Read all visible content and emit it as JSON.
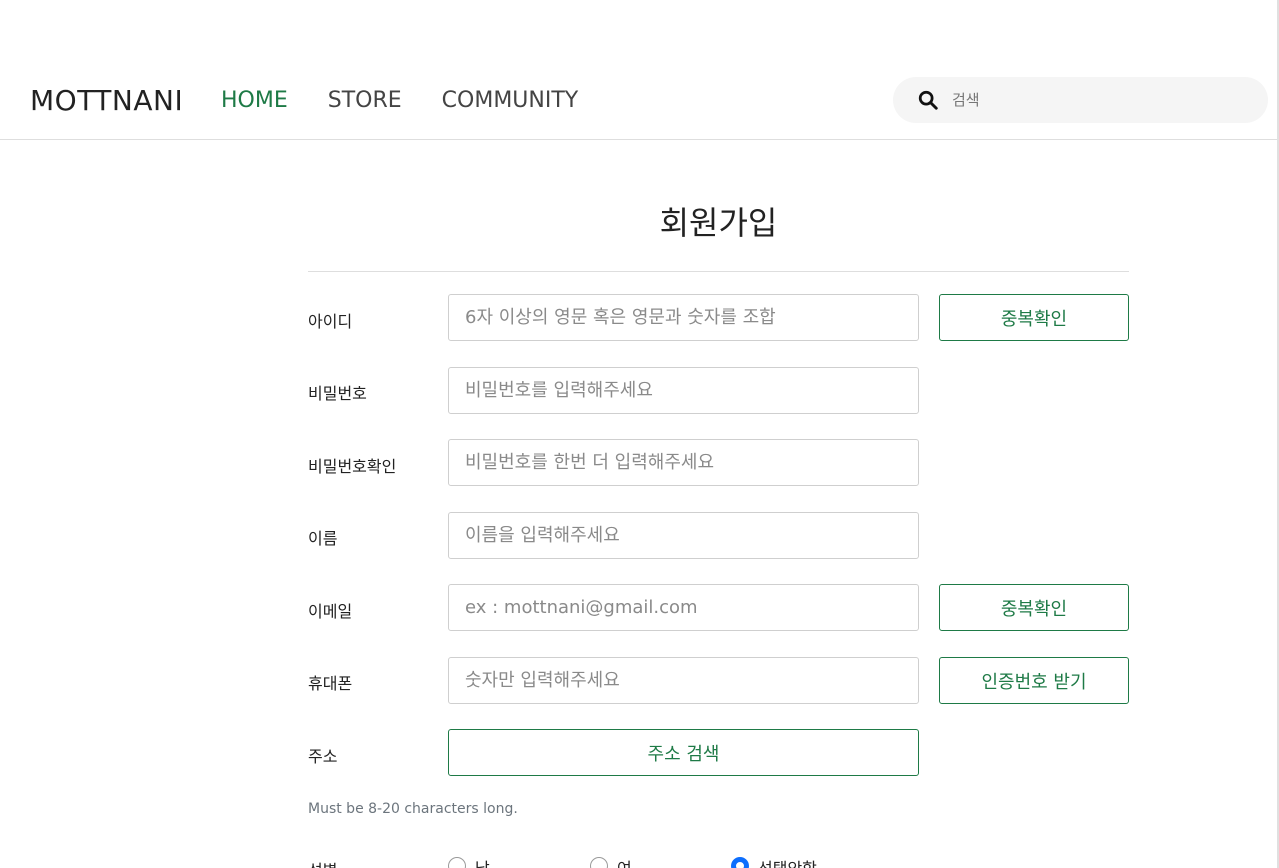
{
  "header": {
    "logo": "MOTTNANI",
    "nav": [
      {
        "label": "HOME",
        "active": true
      },
      {
        "label": "STORE",
        "active": false
      },
      {
        "label": "COMMUNITY",
        "active": false
      }
    ],
    "search": {
      "placeholder": "검색",
      "icon": "search-icon"
    }
  },
  "page": {
    "title": "회원가입"
  },
  "form": {
    "id": {
      "label": "아이디",
      "placeholder": "6자 이상의 영문 혹은 영문과 숫자를 조합",
      "button": "중복확인"
    },
    "password": {
      "label": "비밀번호",
      "placeholder": "비밀번호를 입력해주세요"
    },
    "password_confirm": {
      "label": "비밀번호확인",
      "placeholder": "비밀번호를 한번 더 입력해주세요"
    },
    "name": {
      "label": "이름",
      "placeholder": "이름을 입력해주세요"
    },
    "email": {
      "label": "이메일",
      "placeholder": "ex : mottnani@gmail.com",
      "button": "중복확인"
    },
    "phone": {
      "label": "휴대폰",
      "placeholder": "숫자만 입력해주세요",
      "button": "인증번호 받기"
    },
    "address": {
      "label": "주소",
      "button": "주소 검색"
    },
    "help_text": "Must be 8-20 characters long.",
    "gender": {
      "label": "성별",
      "options": [
        {
          "label": "남",
          "checked": false
        },
        {
          "label": "여",
          "checked": false
        },
        {
          "label": "선택안함",
          "checked": true
        }
      ]
    }
  },
  "colors": {
    "accent": "#1e7a46",
    "radio_checked": "#0d6efd"
  }
}
